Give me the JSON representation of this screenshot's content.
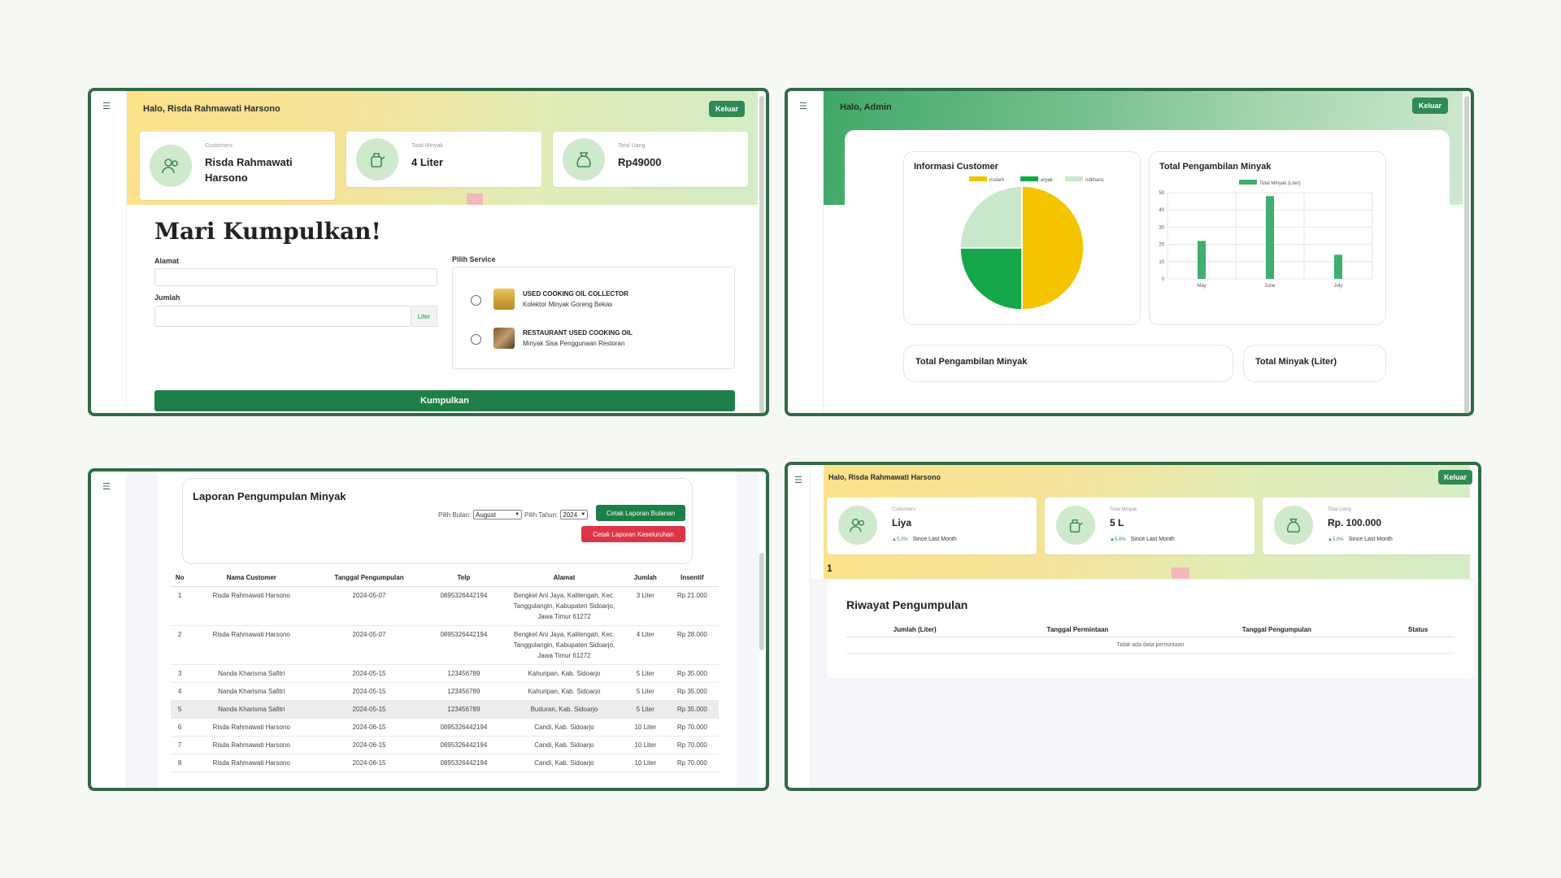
{
  "colors": {
    "brand_green": "#1e7e48",
    "frame": "#2f6b45",
    "danger": "#dc3545",
    "chart_yellow": "#f5c400",
    "chart_green": "#14a84a",
    "chart_light": "#c9e8cb",
    "bar": "#3fae6e"
  },
  "menu_icon": "☰",
  "panel1": {
    "greeting": "Halo, Risda Rahmawati Harsono",
    "logout": "Keluar",
    "stats": [
      {
        "label": "Customers",
        "value": "Risda Rahmawati Harsono",
        "icon": "users-icon"
      },
      {
        "label": "Total Minyak",
        "value": "4 Liter",
        "icon": "oil-jug-icon"
      },
      {
        "label": "Total Uang",
        "value": "Rp49000",
        "icon": "money-bag-icon"
      }
    ],
    "title": "Mari Kumpulkan!",
    "alamat_label": "Alamat",
    "alamat_value": "",
    "jumlah_label": "Jumlah",
    "jumlah_value": "",
    "jumlah_unit": "Liter",
    "service_label": "Pilih Service",
    "services": [
      {
        "title": "USED COOKING OIL COLLECTOR",
        "subtitle": "Kolektor Minyak Goreng Bekas"
      },
      {
        "title": "RESTAURANT USED COOKING OIL",
        "subtitle": "Minyak Sisa Penggunaan Restoran"
      }
    ],
    "submit": "Kumpulkan"
  },
  "panel2": {
    "greeting": "Halo, Admin",
    "logout": "Keluar",
    "pie_title": "Informasi Customer",
    "bar_title": "Total Pengambilan Minyak",
    "card_total_pengambilan": "Total Pengambilan Minyak",
    "card_total_minyak": "Total Minyak (Liter)",
    "chart_data": [
      {
        "type": "pie",
        "title": "Informasi Customer",
        "series": [
          {
            "name": "risdarh",
            "value": 50,
            "color": "#f5c400"
          },
          {
            "name": "aryak",
            "value": 25,
            "color": "#14a84a"
          },
          {
            "name": "ndkharis",
            "value": 25,
            "color": "#c9e8cb"
          }
        ]
      },
      {
        "type": "bar",
        "title": "Total Pengambilan Minyak",
        "categories": [
          "May",
          "June",
          "July"
        ],
        "series": [
          {
            "name": "Total Minyak (Liter)",
            "values": [
              22,
              48,
              14
            ]
          }
        ],
        "ylim": [
          0,
          50
        ],
        "yticks": [
          0,
          10,
          20,
          30,
          40,
          50
        ],
        "grid": true,
        "legend": "top"
      }
    ]
  },
  "panel3": {
    "title": "Laporan Pengumpulan Minyak",
    "bulan_label": "Pilih Bulan:",
    "bulan_value": "August",
    "tahun_label": "Pilih Tahun:",
    "tahun_value": "2024",
    "btn_bulanan": "Cetak Laporan Bulanan",
    "btn_keseluruhan": "Cetak Laporan Keseluruhan",
    "columns": [
      "No",
      "Nama Customer",
      "Tanggal Pengumpulan",
      "Telp",
      "Alamat",
      "Jumlah",
      "Insentif"
    ],
    "rows": [
      [
        "1",
        "Risda Rahmawati Harsono",
        "2024-05-07",
        "0895326442194",
        "Bengkel Ani Jaya, Kalitengah, Kec. Tanggulangin, Kabupaten Sidoarjo, Jawa Timur 61272",
        "3 Liter",
        "Rp 21.000"
      ],
      [
        "2",
        "Risda Rahmawati Harsono",
        "2024-05-07",
        "0895326442194",
        "Bengkel Ani Jaya, Kalitengah, Kec. Tanggulangin, Kabupaten Sidoarjo, Jawa Timur 61272",
        "4 Liter",
        "Rp 28.000"
      ],
      [
        "3",
        "Nanda Kharisma Safitri",
        "2024-05-15",
        "123456789",
        "Kahuripan, Kab. Sidoarjo",
        "5 Liter",
        "Rp 35.000"
      ],
      [
        "4",
        "Nanda Kharisma Safitri",
        "2024-05-15",
        "123456789",
        "Kahuripan, Kab. Sidoarjo",
        "5 Liter",
        "Rp 35.000"
      ],
      [
        "5",
        "Nanda Kharisma Safitri",
        "2024-05-15",
        "123456789",
        "Buduran, Kab. Sidoarjo",
        "5 Liter",
        "Rp 35.000"
      ],
      [
        "6",
        "Risda Rahmawati Harsono",
        "2024-06-15",
        "0895326442194",
        "Candi, Kab. Sidoarjo",
        "10 Liter",
        "Rp 70.000"
      ],
      [
        "7",
        "Risda Rahmawati Harsono",
        "2024-06-15",
        "0895326442194",
        "Candi, Kab. Sidoarjo",
        "10 Liter",
        "Rp 70.000"
      ],
      [
        "8",
        "Risda Rahmawati Harsono",
        "2024-06-15",
        "0895326442194",
        "Candi, Kab. Sidoarjo",
        "10 Liter",
        "Rp 70.000"
      ]
    ]
  },
  "panel4": {
    "greeting": "Halo, Risda Rahmawati Harsono",
    "logout": "Keluar",
    "stats": [
      {
        "label": "Customers",
        "value": "Liya",
        "change": "▲5,0%",
        "since": "Since Last Month"
      },
      {
        "label": "Total Minyak",
        "value": "5 L",
        "change": "▲5,0%",
        "since": "Since Last Month"
      },
      {
        "label": "Total Uang",
        "value": "Rp. 100.000",
        "change": "▲5,0%",
        "since": "Since Last Month"
      }
    ],
    "page_num": "1",
    "history_title": "Riwayat Pengumpulan",
    "columns": [
      "Jumlah (Liter)",
      "Tanggal Permintaan",
      "Tanggal Pengumpulan",
      "Status"
    ],
    "empty": "Tidak ada data permintaan"
  }
}
